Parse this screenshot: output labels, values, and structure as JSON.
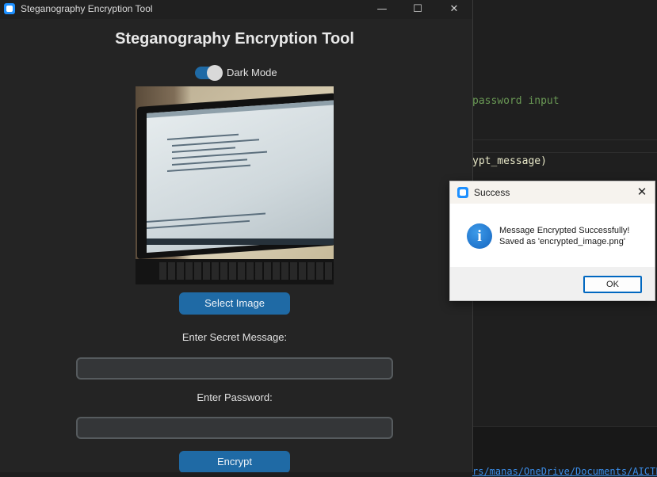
{
  "window": {
    "title": "Steganography Encryption Tool",
    "minimize_glyph": "—",
    "maximize_glyph": "☐",
    "close_glyph": "✕"
  },
  "app": {
    "heading": "Steganography Encryption Tool",
    "dark_mode_label": "Dark Mode",
    "dark_mode_on": true,
    "image_alt": "laptop-screen-photo",
    "select_image_label": "Select Image",
    "message_label": "Enter Secret Message:",
    "message_value": "",
    "password_label": "Enter Password:",
    "password_value": "",
    "encrypt_label": "Encrypt"
  },
  "editor": {
    "line1": "password input",
    "line2": "ypt_message)",
    "terminal": "rs/manas/OneDrive/Documents/AICTE"
  },
  "dialog": {
    "title": "Success",
    "close_glyph": "✕",
    "icon": "info-icon",
    "message_line1": "Message Encrypted Successfully!",
    "message_line2": "Saved as 'encrypted_image.png'",
    "ok_label": "OK"
  },
  "colors": {
    "accent": "#1f6aa5",
    "window_bg": "#242424",
    "editor_comment": "#6a9955",
    "editor_text": "#dcdcaa"
  }
}
